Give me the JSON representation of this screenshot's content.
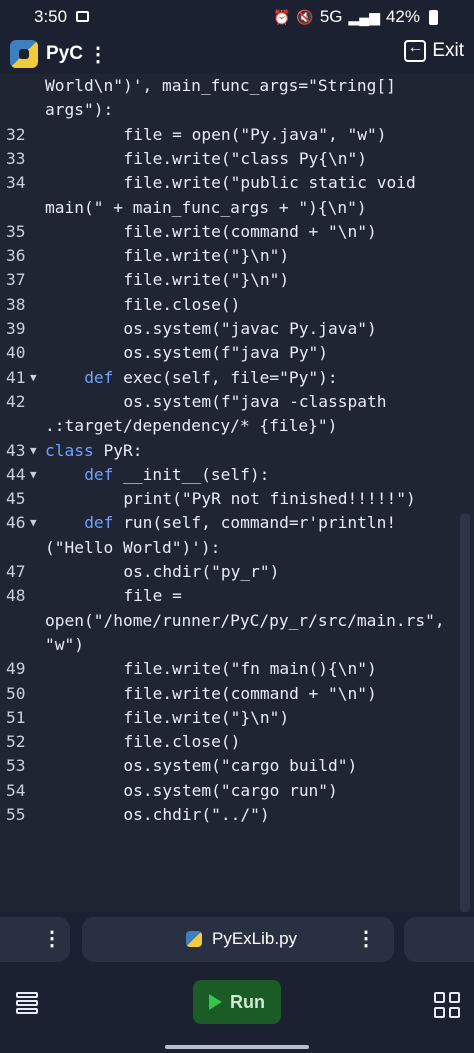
{
  "status": {
    "time": "3:50",
    "network": "5G",
    "battery": "42%"
  },
  "app": {
    "title": "PyC",
    "menu": "⋮",
    "exit_label": "Exit"
  },
  "editor": {
    "lines": [
      {
        "n": "",
        "fold": false,
        "indent": 0,
        "parts": [
          [
            "World\\n\")', main_func_args=\"String[]",
            ""
          ]
        ]
      },
      {
        "n": "",
        "fold": false,
        "indent": 0,
        "parts": [
          [
            "args\"):",
            ""
          ]
        ]
      },
      {
        "n": "32",
        "fold": false,
        "indent": 8,
        "parts": [
          [
            "file = open(\"Py.java\", \"w\")",
            ""
          ]
        ]
      },
      {
        "n": "33",
        "fold": false,
        "indent": 8,
        "parts": [
          [
            "file.write(\"class Py{\\n\")",
            ""
          ]
        ]
      },
      {
        "n": "34",
        "fold": false,
        "indent": 8,
        "parts": [
          [
            "file.write(\"public static void",
            ""
          ]
        ]
      },
      {
        "n": "",
        "fold": false,
        "indent": 0,
        "parts": [
          [
            "main(\" + main_func_args + \"){\\n\")",
            ""
          ]
        ]
      },
      {
        "n": "35",
        "fold": false,
        "indent": 8,
        "parts": [
          [
            "file.write(command + \"\\n\")",
            ""
          ]
        ]
      },
      {
        "n": "36",
        "fold": false,
        "indent": 8,
        "parts": [
          [
            "file.write(\"}\\n\")",
            ""
          ]
        ]
      },
      {
        "n": "37",
        "fold": false,
        "indent": 8,
        "parts": [
          [
            "file.write(\"}\\n\")",
            ""
          ]
        ]
      },
      {
        "n": "38",
        "fold": false,
        "indent": 8,
        "parts": [
          [
            "file.close()",
            ""
          ]
        ]
      },
      {
        "n": "39",
        "fold": false,
        "indent": 8,
        "parts": [
          [
            "os.system(\"javac Py.java\")",
            ""
          ]
        ]
      },
      {
        "n": "40",
        "fold": false,
        "indent": 8,
        "parts": [
          [
            "os.system(f\"java Py\")",
            ""
          ]
        ]
      },
      {
        "n": "41",
        "fold": true,
        "indent": 4,
        "parts": [
          [
            "def",
            "kw"
          ],
          [
            " exec(self, file=\"Py\"):",
            ""
          ]
        ]
      },
      {
        "n": "42",
        "fold": false,
        "indent": 8,
        "parts": [
          [
            "os.system(f\"java -classpath",
            ""
          ]
        ]
      },
      {
        "n": "",
        "fold": false,
        "indent": 0,
        "parts": [
          [
            ".:target/dependency/* {file}\")",
            ""
          ]
        ]
      },
      {
        "n": "43",
        "fold": true,
        "indent": 0,
        "parts": [
          [
            "class",
            "kw"
          ],
          [
            " PyR:",
            ""
          ]
        ]
      },
      {
        "n": "44",
        "fold": true,
        "indent": 4,
        "parts": [
          [
            "def",
            "kw"
          ],
          [
            " __init__(self):",
            ""
          ]
        ]
      },
      {
        "n": "45",
        "fold": false,
        "indent": 8,
        "parts": [
          [
            "print(\"PyR not finished!!!!!\")",
            ""
          ]
        ]
      },
      {
        "n": "46",
        "fold": true,
        "indent": 4,
        "parts": [
          [
            "def",
            "kw"
          ],
          [
            " run(self, command=r'println!",
            ""
          ]
        ]
      },
      {
        "n": "",
        "fold": false,
        "indent": 0,
        "parts": [
          [
            "(\"Hello World\")'):",
            ""
          ]
        ]
      },
      {
        "n": "47",
        "fold": false,
        "indent": 8,
        "parts": [
          [
            "os.chdir(\"py_r\")",
            ""
          ]
        ]
      },
      {
        "n": "48",
        "fold": false,
        "indent": 8,
        "parts": [
          [
            "file =",
            ""
          ]
        ]
      },
      {
        "n": "",
        "fold": false,
        "indent": 0,
        "parts": [
          [
            "open(\"/home/runner/PyC/py_r/src/main.rs\",",
            ""
          ]
        ]
      },
      {
        "n": "",
        "fold": false,
        "indent": 0,
        "parts": [
          [
            "\"w\")",
            ""
          ]
        ]
      },
      {
        "n": "49",
        "fold": false,
        "indent": 8,
        "parts": [
          [
            "file.write(\"fn main(){\\n\")",
            ""
          ]
        ]
      },
      {
        "n": "50",
        "fold": false,
        "indent": 8,
        "parts": [
          [
            "file.write(command + \"\\n\")",
            ""
          ]
        ]
      },
      {
        "n": "51",
        "fold": false,
        "indent": 8,
        "parts": [
          [
            "file.write(\"}\\n\")",
            ""
          ]
        ]
      },
      {
        "n": "52",
        "fold": false,
        "indent": 8,
        "parts": [
          [
            "file.close()",
            ""
          ]
        ]
      },
      {
        "n": "53",
        "fold": false,
        "indent": 8,
        "parts": [
          [
            "os.system(\"cargo build\")",
            ""
          ]
        ]
      },
      {
        "n": "54",
        "fold": false,
        "indent": 8,
        "parts": [
          [
            "os.system(\"cargo run\")",
            ""
          ]
        ]
      },
      {
        "n": "55",
        "fold": false,
        "indent": 8,
        "parts": [
          [
            "os.chdir(\"../\")",
            ""
          ]
        ]
      }
    ]
  },
  "tabs": {
    "active_file": "PyExLib.py",
    "menu": "⋮"
  },
  "bottom": {
    "run_label": "Run"
  },
  "colors": {
    "keyword": "#6ea2ff",
    "background": "#1f2533",
    "run_button": "#1b5b25"
  },
  "icons": [
    "gallery-icon",
    "python-logo-icon",
    "exit-icon",
    "layers-icon",
    "play-icon",
    "grid-icon"
  ]
}
